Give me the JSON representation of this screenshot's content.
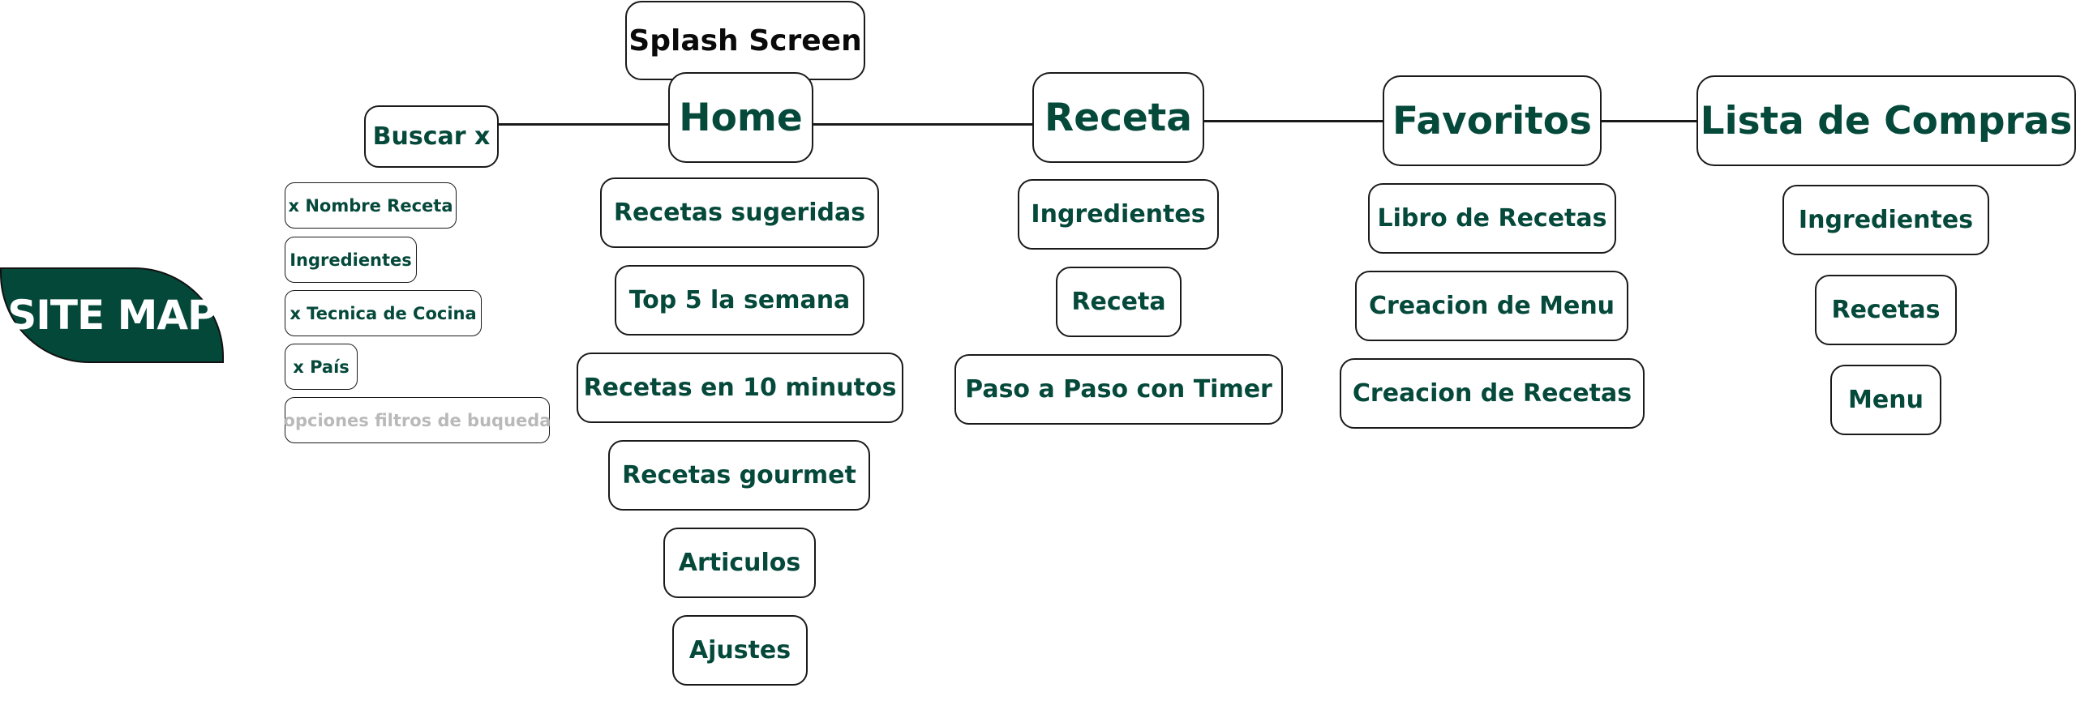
{
  "title_badge": "SITE MAP",
  "colors": {
    "brand_green": "#04483a",
    "text_green": "#05493b",
    "muted": "#b9b9b9"
  },
  "splash": "Splash Screen",
  "search": {
    "label": "Buscar x",
    "filters": [
      "x Nombre Receta",
      "Ingredientes",
      "x Tecnica de Cocina",
      "x País"
    ],
    "placeholder_note": "opciones filtros de buqueda"
  },
  "sections": [
    {
      "label": "Home",
      "children": [
        "Recetas sugeridas",
        "Top 5 la semana",
        "Recetas en 10 minutos",
        "Recetas gourmet",
        "Articulos",
        "Ajustes"
      ]
    },
    {
      "label": "Receta",
      "children": [
        "Ingredientes",
        "Receta",
        "Paso a Paso con Timer"
      ]
    },
    {
      "label": "Favoritos",
      "children": [
        "Libro de Recetas",
        "Creacion de Menu",
        "Creacion de Recetas"
      ]
    },
    {
      "label": "Lista de Compras",
      "children": [
        "Ingredientes",
        "Recetas",
        "Menu"
      ]
    }
  ]
}
